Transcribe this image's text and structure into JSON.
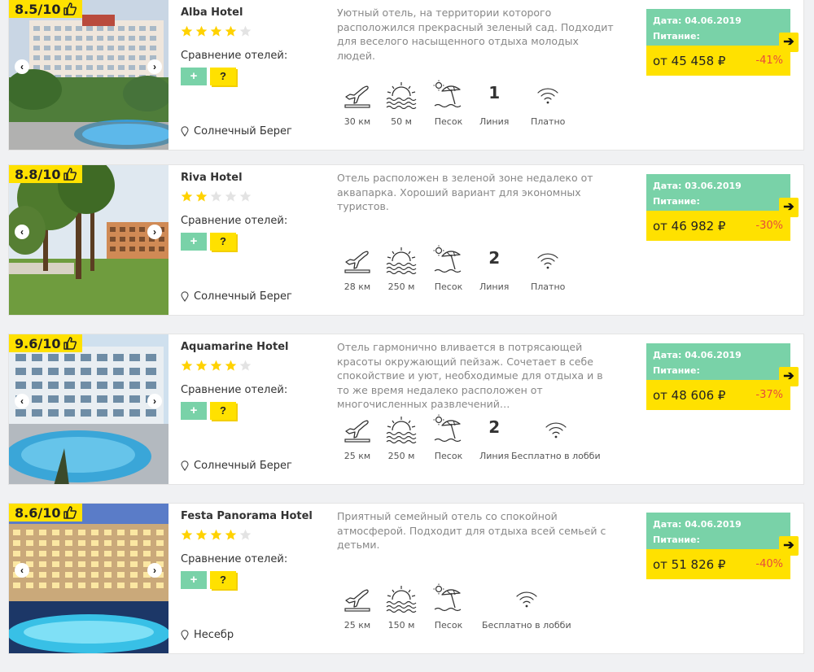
{
  "common": {
    "compare_label": "Сравнение отелей:",
    "plus_label": "+",
    "question_label": "?",
    "prev_label": "‹",
    "next_label": "›",
    "go_label": "➔",
    "date_prefix": "Дата: ",
    "food_label": "Питание:",
    "colors": {
      "accent_yellow": "#ffe100",
      "accent_green": "#79d2a8",
      "discount_red": "#e74c3c"
    },
    "icons": [
      "thumbs-up-icon",
      "star-icon",
      "location-pin-icon",
      "airplane-icon",
      "sea-icon",
      "beach-umbrella-icon",
      "wifi-icon",
      "chevron-left-icon",
      "chevron-right-icon",
      "arrow-right-icon"
    ]
  },
  "hotels": [
    {
      "rating": "8.5/10",
      "name": "Alba Hotel",
      "stars": 4,
      "location": "Солнечный Берег",
      "description": "Уютный отель, на территории которого расположился прекрасный зеленый сад. Подходит для веселого насыщенного отдыха молодых людей.",
      "airport": "30 км",
      "sea": "50 м",
      "beach": "Песок",
      "line_num": "1",
      "line_label": "Линия",
      "wifi": "Платно",
      "date": "04.06.2019",
      "price": "от 45 458 ₽",
      "discount": "-41%"
    },
    {
      "rating": "8.8/10",
      "name": "Riva Hotel",
      "stars": 2,
      "location": "Солнечный Берег",
      "description": "Отель расположен в зеленой зоне недалеко от аквапарка. Хороший вариант для экономных туристов.",
      "airport": "28 км",
      "sea": "250 м",
      "beach": "Песок",
      "line_num": "2",
      "line_label": "Линия",
      "wifi": "Платно",
      "date": "03.06.2019",
      "price": "от 46 982 ₽",
      "discount": "-30%"
    },
    {
      "rating": "9.6/10",
      "name": "Aquamarine Hotel",
      "stars": 4,
      "location": "Солнечный Берег",
      "description": "Отель гармонично вливается в потрясающей красоты окружающий пейзаж. Сочетает в себе спокойствие и уют, необходимые для отдыха и в то же время недалеко расположен от многочисленных развлечений…",
      "airport": "25 км",
      "sea": "250 м",
      "beach": "Песок",
      "line_num": "2",
      "line_label": "Линия",
      "wifi": "Бесплатно в лобби",
      "date": "04.06.2019",
      "price": "от 48 606 ₽",
      "discount": "-37%"
    },
    {
      "rating": "8.6/10",
      "name": "Festa Panorama Hotel",
      "stars": 4,
      "location": "Несебр",
      "description": "Приятный семейный отель со спокойной атмосферой. Подходит для отдыха всей семьей с детьми.",
      "airport": "25 км",
      "sea": "150 м",
      "beach": "Песок",
      "line_num": "",
      "line_label": "",
      "wifi": "Бесплатно в лобби",
      "date": "04.06.2019",
      "price": "от 51 826 ₽",
      "discount": "-40%"
    }
  ]
}
